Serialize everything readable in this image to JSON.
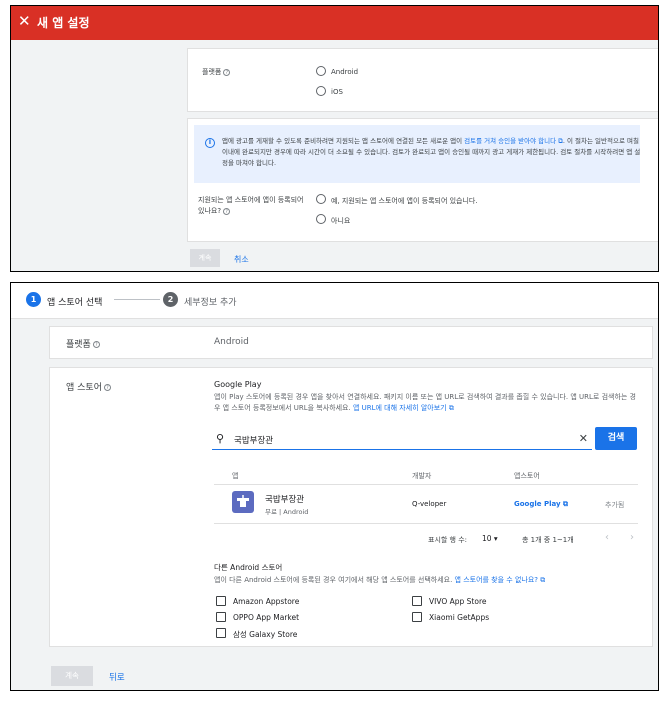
{
  "top": {
    "close_glyph": "✕",
    "title": "새 앱 설정",
    "platform_label": "플랫폼",
    "platform_options": [
      "Android",
      "iOS"
    ],
    "info_text_1": "앱에 광고를 게재할 수 있도록 준비하려면 지원되는 앱 스토어에 연결된 모든 새로운 앱이 ",
    "info_link": "검토를 거쳐 승인을 받아야 합니다",
    "info_text_2": ". 이 절차는 일반적으로 며칠 이내에 완료되지만 경우에 따라 시간이 더 소요될 수 있습니다. 검토가 완료되고 앱이 승인될 때까지 광고 게재가 제한됩니다. 검토 절차를 시작하려면 앱 설정을 마쳐야 합니다.",
    "question_label": "지원되는 앱 스토어에 앱이 등록되어 있나요?",
    "answer_yes": "예, 지원되는 앱 스토어에 앱이 등록되어 있습니다.",
    "answer_no": "아니요",
    "continue_label": "계속",
    "cancel_label": "취소"
  },
  "bottom": {
    "steps": [
      {
        "number": "1",
        "label": "앱 스토어 선택"
      },
      {
        "number": "2",
        "label": "세부정보 추가"
      }
    ],
    "platform_label": "플랫폼",
    "platform_value": "Android",
    "appstore_label": "앱 스토어",
    "store_title": "Google Play",
    "store_desc_1": "앱이 Play 스토어에 등록된 경우 앱을 찾아서 연결하세요. 패키지 이름 또는 앱 URL로 검색하여 결과를 좁힐 수 있습니다. 앱 URL로 검색하는 경우 앱 스토어 등록정보에서 URL을 복사하세요. ",
    "store_desc_link": "앱 URL에 대해 자세히 알아보기",
    "search_value": "국밥부장관",
    "search_button": "검색",
    "table_headers": [
      "앱",
      "개발자",
      "앱스토어"
    ],
    "result": {
      "app_name": "국밥부장관",
      "app_sub": "무료 | Android",
      "developer": "Q-veloper",
      "store_link": "Google Play",
      "action": "추가됨"
    },
    "rows_per_page_label": "표시할 행 수:",
    "rows_per_page_value": "10",
    "range_text": "총 1개 중 1~1개",
    "other_title": "다른 Android 스토어",
    "other_desc": "앱이 다른 Android 스토어에 등록된 경우 여기에서 해당 앱 스토어를 선택하세요. ",
    "other_link": "앱 스토어를 찾을 수 없나요?",
    "stores_left": [
      "Amazon Appstore",
      "OPPO App Market",
      "삼성 Galaxy Store"
    ],
    "stores_right": [
      "VIVO App Store",
      "Xiaomi GetApps"
    ],
    "continue_label": "계속",
    "back_label": "뒤로"
  },
  "colors": {
    "header_red": "#d93025",
    "accent_blue": "#1a73e8",
    "step_inactive": "#5f6368"
  }
}
